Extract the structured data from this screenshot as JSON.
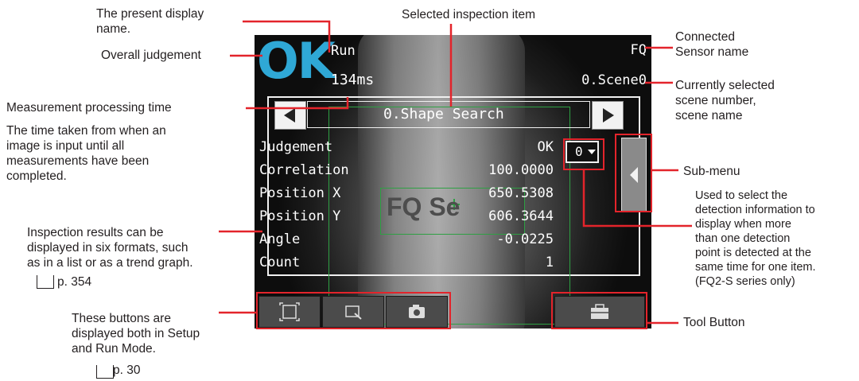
{
  "callouts": {
    "display_name": "The present display\nname.",
    "overall_judgement": "Overall judgement",
    "processing_time_title": "Measurement processing time",
    "processing_time_desc": "The time taken from when an\nimage is input until all\nmeasurements have been\ncompleted.",
    "inspection_results": "Inspection results can be\ndisplayed in six formats, such\nas in a list or as a trend graph.",
    "inspection_results_ref": "p. 354",
    "buttons_desc": "These buttons are\ndisplayed both in Setup\nand Run Mode.",
    "buttons_ref": "p. 30",
    "selected_item": "Selected inspection item",
    "connected_sensor": "Connected\nSensor name",
    "scene_info": "Currently selected\nscene number,\nscene name",
    "submenu": "Sub-menu",
    "detection_info": "Used to select the\ndetection information to\ndisplay when more\nthan one detection\npoint is detected at the\nsame time for one item.\n(FQ2-S series only)",
    "tool_button": "Tool Button"
  },
  "screen": {
    "judgement": "OK",
    "mode": "Run",
    "processing_time": "134ms",
    "sensor_name": "FQ",
    "scene": "0.Scene0",
    "inspection_item": "0.Shape Search",
    "background_text": "FQ Se",
    "detection_index": "0",
    "results": [
      {
        "label": "Judgement",
        "value": "OK"
      },
      {
        "label": "Correlation",
        "value": "100.0000"
      },
      {
        "label": "Position X",
        "value": "650.5308"
      },
      {
        "label": "Position Y",
        "value": "606.3644"
      },
      {
        "label": "Angle",
        "value": "-0.0225"
      },
      {
        "label": "Count",
        "value": "1"
      }
    ]
  },
  "colors": {
    "annotation_red": "#e3242b",
    "judgement_ok": "#2fa8d6",
    "roi_green": "#2ea043"
  },
  "icons": [
    "left-arrow-icon",
    "right-arrow-icon",
    "zoom-frame-icon",
    "zoom-search-icon",
    "camera-icon",
    "toolbox-icon",
    "dropdown-arrow-icon",
    "book-icon"
  ]
}
